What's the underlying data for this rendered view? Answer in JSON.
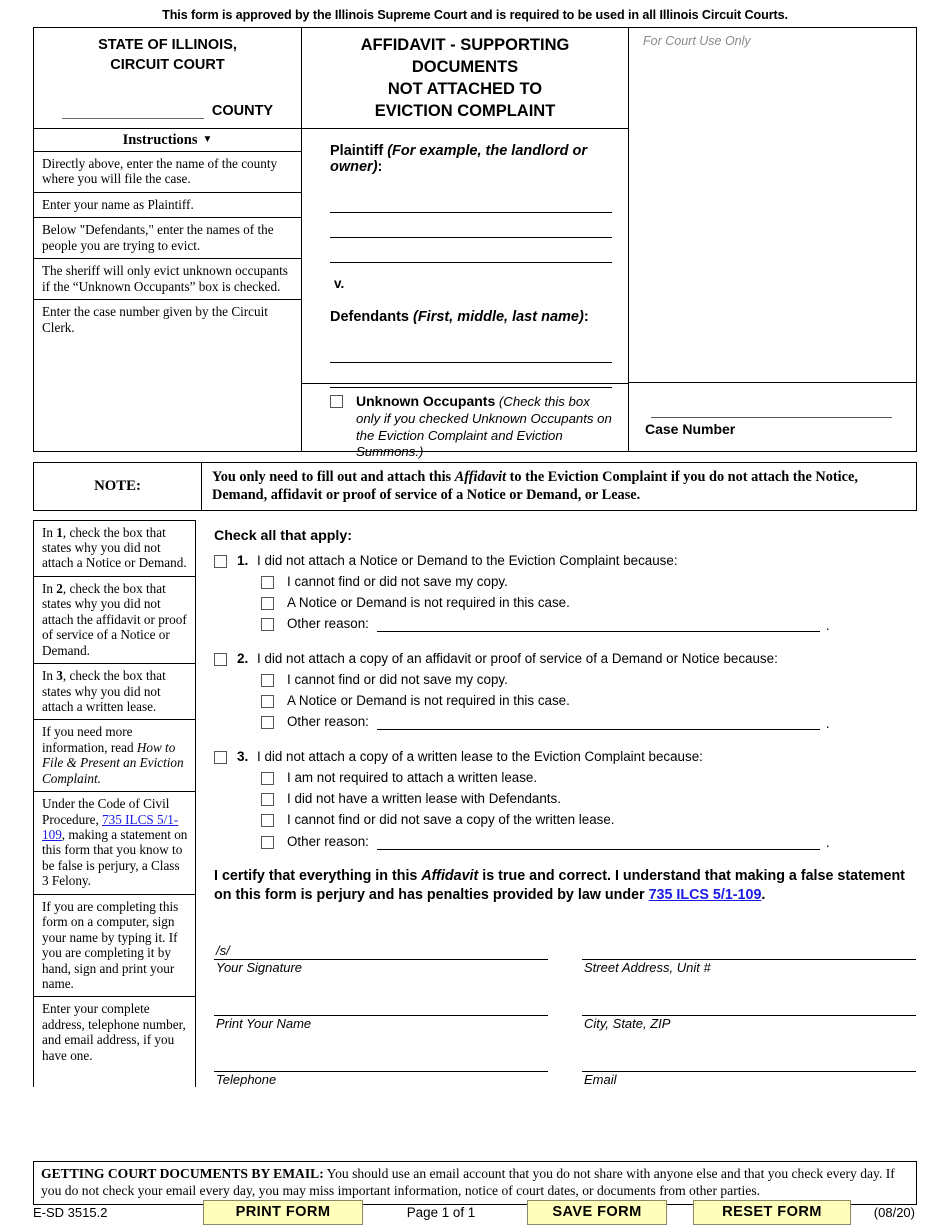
{
  "approval_notice": "This form is approved by the Illinois Supreme Court and is required to be used in all Illinois Circuit Courts.",
  "caption": {
    "state_line1": "STATE OF ILLINOIS,",
    "state_line2": "CIRCUIT COURT",
    "county_label": "COUNTY",
    "title_lines": [
      "AFFIDAVIT - SUPPORTING",
      "DOCUMENTS",
      "NOT ATTACHED TO",
      "EVICTION COMPLAINT"
    ],
    "court_use_label": "For Court Use Only",
    "case_number_label": "Case Number"
  },
  "instructions": {
    "header": "Instructions",
    "caret": "▼",
    "items_top": [
      "Directly above, enter the name of the county where you will file the case.",
      "Enter your name as Plaintiff.",
      "Below \"Defendants,\" enter the names of the people you are trying to evict.",
      "The sheriff will only evict unknown occupants if the “Unknown Occupants” box is checked.",
      "Enter the case number given by the Circuit Clerk."
    ],
    "items_bottom": [
      {
        "parts": [
          {
            "t": "In "
          },
          {
            "t": "1",
            "style": "bold"
          },
          {
            "t": ", check the box that states why you did not attach a Notice or Demand."
          }
        ]
      },
      {
        "parts": [
          {
            "t": "In "
          },
          {
            "t": "2",
            "style": "bold"
          },
          {
            "t": ", check the box that states why you did not attach the affidavit or proof of service of a Notice or Demand."
          }
        ]
      },
      {
        "parts": [
          {
            "t": "In "
          },
          {
            "t": "3",
            "style": "bold"
          },
          {
            "t": ", check the box that states why you did not attach a written lease."
          }
        ]
      },
      {
        "parts": [
          {
            "t": "If you need more information, read "
          },
          {
            "t": "How to File & Present an Eviction Complaint.",
            "style": "italic"
          }
        ]
      },
      {
        "parts": [
          {
            "t": "Under the Code of Civil Procedure, "
          },
          {
            "t": "735 ILCS 5/1-109",
            "style": "link"
          },
          {
            "t": ", making a statement on this form that you know to be false is perjury, a Class 3 Felony."
          }
        ]
      },
      {
        "parts": [
          {
            "t": "If you are completing this form on a computer, sign your name by typing it. If you are completing it by hand, sign and print your name."
          }
        ]
      },
      {
        "parts": [
          {
            "t": "Enter your complete address, telephone number, and email address, if you have one."
          }
        ]
      }
    ]
  },
  "parties": {
    "plaintiff_label": "Plaintiff",
    "plaintiff_hint": "(For example, the landlord or owner)",
    "versus": "v.",
    "defendants_label": "Defendants",
    "defendants_hint": "(First, middle, last name)",
    "unknown_occupants_label": "Unknown Occupants",
    "unknown_occupants_hint": "(Check this box only if you checked Unknown Occupants on the Eviction Complaint and Eviction Summons.)",
    "plaintiff_lines": [
      "",
      "",
      ""
    ],
    "defendant_lines": [
      "",
      ""
    ]
  },
  "note": {
    "label": "NOTE:",
    "text_before": "You only need to fill out and attach this ",
    "text_italic": "Affidavit",
    "text_after": " to the Eviction Complaint if you do not attach the Notice, Demand, affidavit or proof of service of a Notice or Demand, or Lease."
  },
  "checklist": {
    "heading": "Check all that apply:",
    "items": [
      {
        "number": "1.",
        "text": "I did not attach a Notice or Demand to the Eviction Complaint because:",
        "options": [
          {
            "text": "I cannot find or did not save my copy.",
            "type": "plain"
          },
          {
            "text": "A Notice or Demand is not required in this case.",
            "type": "plain"
          },
          {
            "text": "Other reason:",
            "type": "other",
            "value": "",
            "period": "."
          }
        ]
      },
      {
        "number": "2.",
        "text": "I did not attach a copy of an affidavit or proof of service of a Demand or Notice because:",
        "options": [
          {
            "text": "I cannot find or did not save my copy.",
            "type": "plain"
          },
          {
            "text": "A Notice or Demand is not required in this case.",
            "type": "plain"
          },
          {
            "text": "Other reason:",
            "type": "other",
            "value": "",
            "period": "."
          }
        ]
      },
      {
        "number": "3.",
        "text": "I did not attach a copy of a written lease to the Eviction Complaint because:",
        "options": [
          {
            "text": "I am not required to attach a written lease.",
            "type": "plain"
          },
          {
            "text": "I did not have a written lease with Defendants.",
            "type": "plain"
          },
          {
            "text": "I cannot find or did not save a copy of the written lease.",
            "type": "plain"
          },
          {
            "text": "Other reason:",
            "type": "other",
            "value": "",
            "period": "."
          }
        ]
      }
    ]
  },
  "certification": {
    "part1": "I certify that everything in this ",
    "italic": "Affidavit",
    "part2": " is true and correct. I understand that making a false statement on this form is perjury and has penalties provided by law under ",
    "link": "735 ILCS 5/1-109",
    "part3": "."
  },
  "signature": {
    "signature_value": "/s/",
    "signature_label": "Your Signature",
    "print_name_value": "",
    "print_name_label": "Print Your Name",
    "telephone_value": "",
    "telephone_label": "Telephone",
    "street_value": "",
    "street_label": "Street Address, Unit #",
    "city_value": "",
    "city_label": "City, State, ZIP",
    "email_value": "",
    "email_label": "Email"
  },
  "email_notice": {
    "heading": "GETTING COURT DOCUMENTS BY EMAIL:",
    "text": " You should use an email account that you do not share with anyone else and that you check every day. If you do not check your email every day, you may miss important information, notice of court dates, or documents from other parties."
  },
  "footer": {
    "form_code": "E-SD 3515.2",
    "print_button": "PRINT FORM",
    "page_number": "Page 1 of 1",
    "save_button": "SAVE FORM",
    "reset_button": "RESET FORM",
    "revision": "(08/20)"
  },
  "colors": {
    "button_fill": "#FFFFBB",
    "link": "#1A1AE6",
    "court_use_text": "#8A8A8A"
  }
}
